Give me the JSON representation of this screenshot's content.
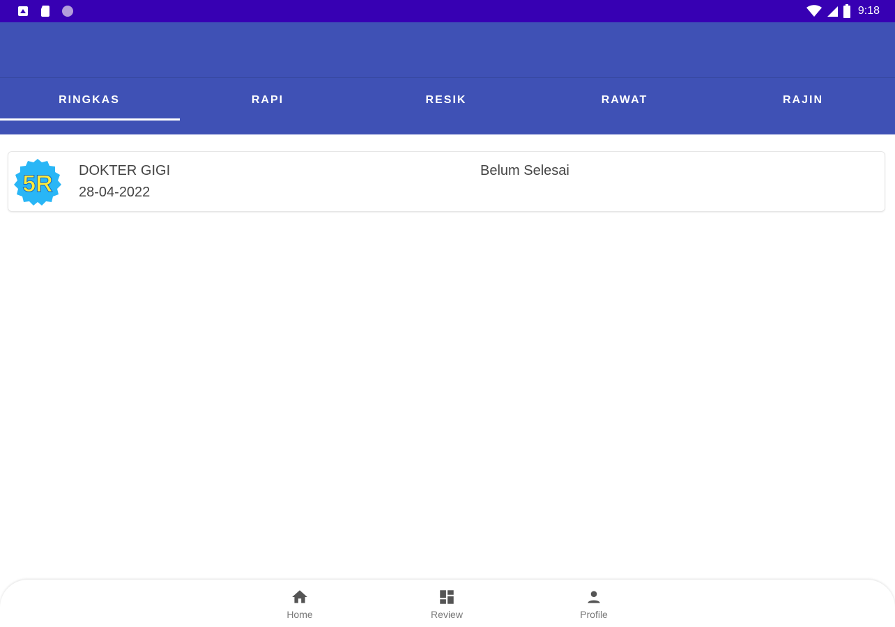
{
  "status_bar": {
    "time": "9:18",
    "left_icons": [
      "notification-icon",
      "sd-card-icon",
      "circle-icon"
    ],
    "right_icons": [
      "wifi-icon",
      "signal-icon",
      "battery-icon"
    ],
    "background": "#3700b3"
  },
  "app_bar": {
    "background": "#3f51b5"
  },
  "tabs": [
    {
      "label": "RINGKAS",
      "selected": true
    },
    {
      "label": "RAPI",
      "selected": false
    },
    {
      "label": "RESIK",
      "selected": false
    },
    {
      "label": "RAWAT",
      "selected": false
    },
    {
      "label": "RAJIN",
      "selected": false
    }
  ],
  "list": {
    "items": [
      {
        "logo_text": "5R",
        "title": "DOKTER GIGI",
        "date": "28-04-2022",
        "status": "Belum Selesai"
      }
    ]
  },
  "bottom_nav": {
    "items": [
      {
        "label": "Home",
        "icon": "home-icon"
      },
      {
        "label": "Review",
        "icon": "dashboard-icon"
      },
      {
        "label": "Profile",
        "icon": "person-icon"
      }
    ]
  },
  "colors": {
    "primary": "#3f51b5",
    "primary_dark": "#3700b3",
    "logo_badge": "#29b6f6",
    "logo_text": "#ffeb3b"
  }
}
